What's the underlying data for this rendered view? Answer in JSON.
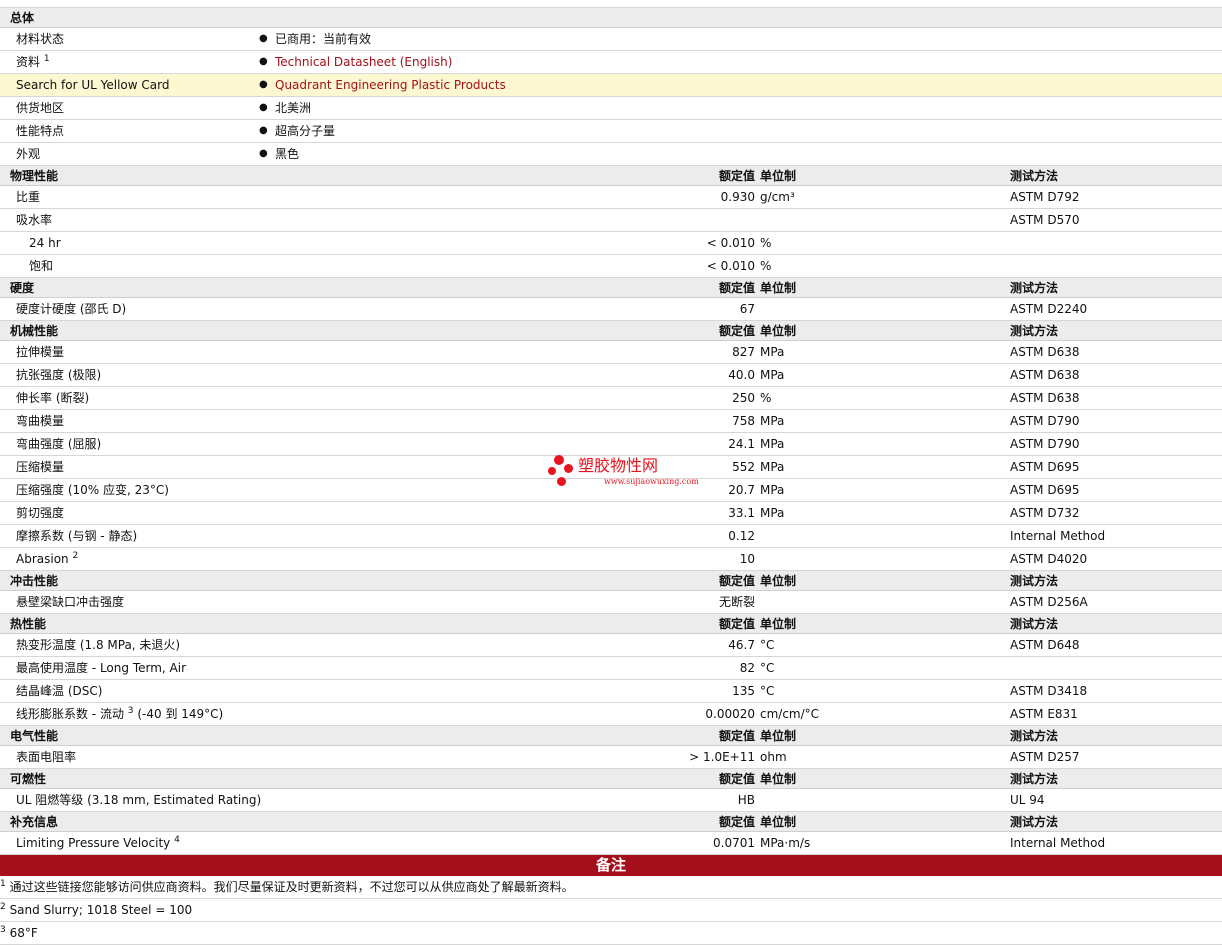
{
  "general": {
    "title": "总体",
    "rows": [
      {
        "label": "材料状态",
        "value": "已商用：当前有效",
        "link": false
      },
      {
        "label": "资料",
        "sup": "1",
        "value": "Technical Datasheet (English)",
        "link": true
      },
      {
        "label": "Search for UL Yellow Card",
        "value": "Quadrant Engineering Plastic Products",
        "link": true,
        "highlight": true
      },
      {
        "label": "供货地区",
        "value": "北美洲",
        "link": false
      },
      {
        "label": "性能特点",
        "value": "超高分子量",
        "link": false
      },
      {
        "label": "外观",
        "value": "黑色",
        "link": false
      }
    ]
  },
  "headers": {
    "nominal": "额定值",
    "unit": "单位制",
    "test": "测试方法"
  },
  "sections": [
    {
      "title": "物理性能",
      "rows": [
        {
          "label": "比重",
          "value": "0.930",
          "unit": "g/cm³",
          "test": "ASTM D792"
        },
        {
          "label": "吸水率",
          "value": "",
          "unit": "",
          "test": "ASTM D570"
        },
        {
          "label": "24 hr",
          "value": "< 0.010",
          "unit": "%",
          "test": "",
          "sub": true
        },
        {
          "label": "饱和",
          "value": "< 0.010",
          "unit": "%",
          "test": "",
          "sub": true
        }
      ]
    },
    {
      "title": "硬度",
      "rows": [
        {
          "label": "硬度计硬度 (邵氏 D)",
          "value": "67",
          "unit": "",
          "test": "ASTM D2240"
        }
      ]
    },
    {
      "title": "机械性能",
      "rows": [
        {
          "label": "拉伸模量",
          "value": "827",
          "unit": "MPa",
          "test": "ASTM D638"
        },
        {
          "label": "抗张强度 (极限)",
          "value": "40.0",
          "unit": "MPa",
          "test": "ASTM D638"
        },
        {
          "label": "伸长率 (断裂)",
          "value": "250",
          "unit": "%",
          "test": "ASTM D638"
        },
        {
          "label": "弯曲模量",
          "value": "758",
          "unit": "MPa",
          "test": "ASTM D790"
        },
        {
          "label": "弯曲强度 (屈服)",
          "value": "24.1",
          "unit": "MPa",
          "test": "ASTM D790"
        },
        {
          "label": "压缩模量",
          "value": "552",
          "unit": "MPa",
          "test": "ASTM D695"
        },
        {
          "label": "压缩强度 (10% 应变, 23°C)",
          "value": "20.7",
          "unit": "MPa",
          "test": "ASTM D695"
        },
        {
          "label": "剪切强度",
          "value": "33.1",
          "unit": "MPa",
          "test": "ASTM D732"
        },
        {
          "label": "摩擦系数 (与钢 - 静态)",
          "value": "0.12",
          "unit": "",
          "test": "Internal Method"
        },
        {
          "label": "Abrasion",
          "sup": "2",
          "value": "10",
          "unit": "",
          "test": "ASTM D4020"
        }
      ]
    },
    {
      "title": "冲击性能",
      "rows": [
        {
          "label": "悬壁梁缺口冲击强度",
          "value": "无断裂",
          "unit": "",
          "test": "ASTM D256A"
        }
      ]
    },
    {
      "title": "热性能",
      "rows": [
        {
          "label": "热变形温度 (1.8 MPa, 未退火)",
          "value": "46.7",
          "unit": "°C",
          "test": "ASTM D648"
        },
        {
          "label": "最高使用温度 - Long Term, Air",
          "value": "82",
          "unit": "°C",
          "test": ""
        },
        {
          "label": "结晶峰温 (DSC)",
          "value": "135",
          "unit": "°C",
          "test": "ASTM D3418"
        },
        {
          "label": "线形膨胀系数 - 流动",
          "sup": "3",
          "label_after": "(-40 到 149°C)",
          "value": "0.00020",
          "unit": "cm/cm/°C",
          "test": "ASTM E831"
        }
      ]
    },
    {
      "title": "电气性能",
      "rows": [
        {
          "label": "表面电阻率",
          "value": "> 1.0E+11",
          "unit": "ohm",
          "test": "ASTM D257"
        }
      ]
    },
    {
      "title": "可燃性",
      "rows": [
        {
          "label": "UL 阻燃等级 (3.18 mm, Estimated Rating)",
          "value": "HB",
          "unit": "",
          "test": "UL 94"
        }
      ]
    },
    {
      "title": "补充信息",
      "rows": [
        {
          "label": "Limiting Pressure Velocity",
          "sup": "4",
          "value": "0.0701",
          "unit": "MPa·m/s",
          "test": "Internal Method"
        }
      ]
    }
  ],
  "notes": {
    "title": "备注",
    "items": [
      {
        "num": "1",
        "text": "通过这些链接您能够访问供应商资料。我们尽量保证及时更新资料，不过您可以从供应商处了解最新资料。"
      },
      {
        "num": "2",
        "text": "Sand Slurry; 1018 Steel = 100"
      },
      {
        "num": "3",
        "text": "68°F"
      }
    ]
  },
  "watermark": {
    "name": "塑胶物性网",
    "url": "www.sujiaowuxing.com"
  },
  "colors": {
    "accent": "#a50f1c",
    "link": "#a1111c",
    "section_bg": "#ececec",
    "highlight_bg": "#fdf7d2"
  }
}
